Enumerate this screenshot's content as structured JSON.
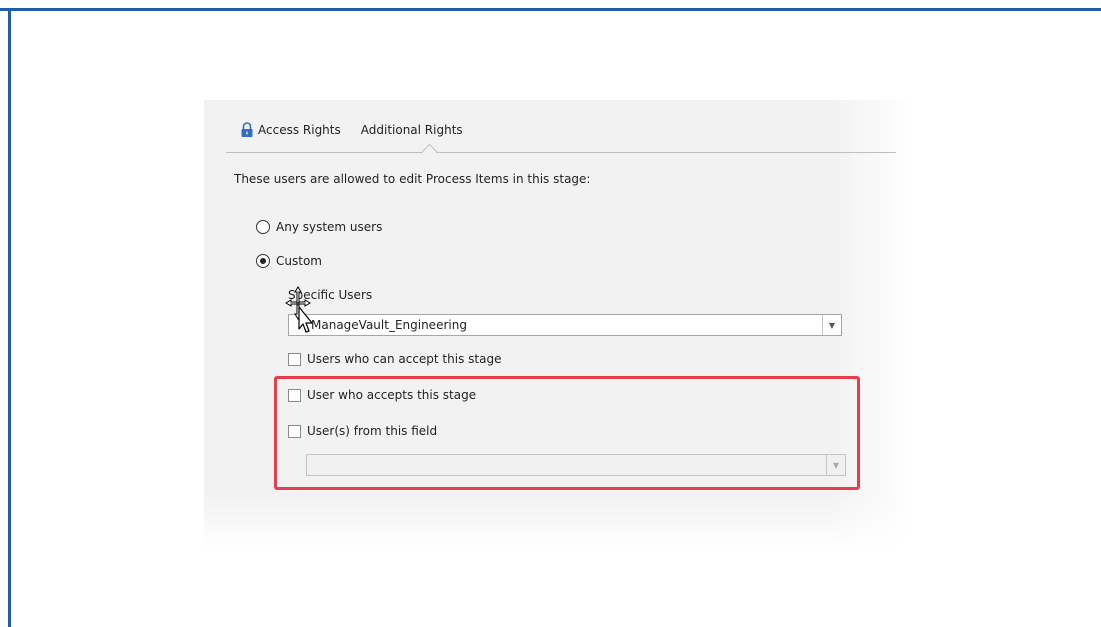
{
  "tabs": [
    {
      "label": "Access Rights",
      "icon": "lock-icon"
    },
    {
      "label": "Additional Rights"
    }
  ],
  "description": "These users are allowed to edit Process Items in this stage:",
  "options": {
    "any_system_users": {
      "label": "Any system users",
      "selected": false
    },
    "custom": {
      "label": "Custom",
      "selected": true
    }
  },
  "specific_users": {
    "label": "Specific Users",
    "value": "ManageVault_Engineering"
  },
  "checkboxes": {
    "can_accept": {
      "label": "Users who can accept this stage",
      "checked": false
    },
    "accepts": {
      "label": "User who accepts this stage",
      "checked": false
    },
    "from_field": {
      "label": "User(s) from this field",
      "checked": false
    }
  },
  "field_select": {
    "value": ""
  },
  "colors": {
    "frame": "#1f5fa6",
    "highlight": "#e83e4a",
    "panel": "#f2f2f2"
  }
}
